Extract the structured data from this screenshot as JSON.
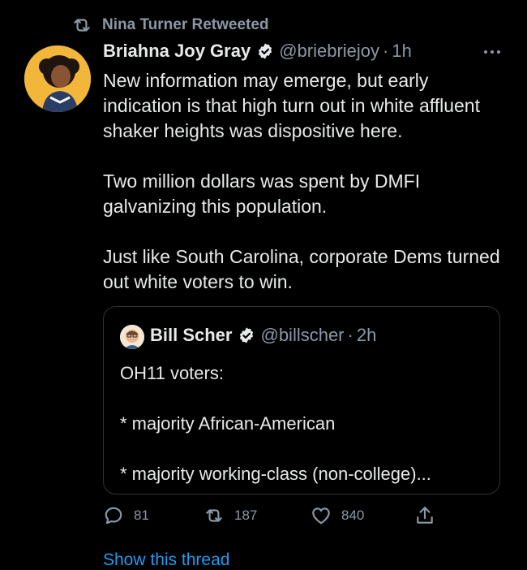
{
  "retweet": {
    "label": "Nina Turner Retweeted"
  },
  "tweet": {
    "author_name": "Briahna Joy Gray",
    "handle": "@briebriejoy",
    "separator": "·",
    "time": "1h",
    "text": "New information may emerge, but early indication is that high turn out in white affluent shaker heights was dispositive here.\n\nTwo million dollars was spent by DMFI galvanizing this population.\n\nJust like South Carolina, corporate Dems turned out white voters to win."
  },
  "quote": {
    "author_name": "Bill Scher",
    "handle": "@billscher",
    "separator": "·",
    "time": "2h",
    "text": "OH11 voters:\n\n* majority African-American\n\n* majority working-class (non-college)..."
  },
  "actions": {
    "replies": "81",
    "retweets": "187",
    "likes": "840"
  },
  "show_thread": {
    "label": "Show this thread"
  },
  "colors": {
    "background": "#000000",
    "text": "#e7e9ea",
    "muted": "#8b98a5",
    "link": "#1d9bf0",
    "avatar_bg": "#f2b73a"
  },
  "icons": [
    "retweet-icon",
    "verified-icon",
    "more-icon",
    "reply-icon",
    "like-icon",
    "share-icon"
  ]
}
